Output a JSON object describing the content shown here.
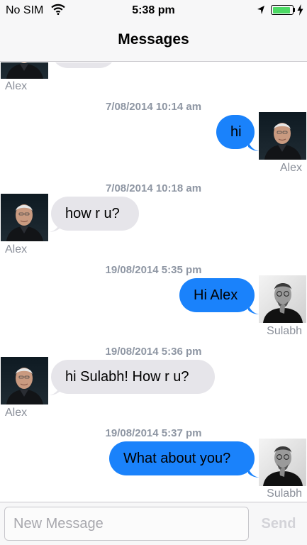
{
  "status_bar": {
    "carrier": "No SIM",
    "time": "5:38 pm",
    "battery_level": 0.92,
    "battery_color": "#4cd964"
  },
  "nav": {
    "title": "Messages"
  },
  "messages": [
    {
      "sender": "Alex",
      "direction": "incoming",
      "text": "",
      "timestamp": "",
      "avatar": "alex-avatar"
    },
    {
      "sender": "Alex",
      "direction": "outgoing",
      "text": "hi",
      "timestamp": "7/08/2014 10:14 am",
      "avatar": "alex-avatar"
    },
    {
      "sender": "Alex",
      "direction": "incoming",
      "text": "how r u?",
      "timestamp": "7/08/2014 10:18 am",
      "avatar": "alex-avatar"
    },
    {
      "sender": "Sulabh",
      "direction": "outgoing",
      "text": "Hi Alex",
      "timestamp": "19/08/2014 5:35 pm",
      "avatar": "sulabh-avatar"
    },
    {
      "sender": "Alex",
      "direction": "incoming",
      "text": "hi Sulabh! How r u?",
      "timestamp": "19/08/2014 5:36 pm",
      "avatar": "alex-avatar"
    },
    {
      "sender": "Sulabh",
      "direction": "outgoing",
      "text": "What about you?",
      "timestamp": "19/08/2014 5:37 pm",
      "avatar": "sulabh-avatar"
    }
  ],
  "input": {
    "placeholder": "New Message",
    "value": "",
    "send_label": "Send"
  },
  "colors": {
    "incoming_bubble": "#e6e5ea",
    "outgoing_bubble": "#1a82fb",
    "timestamp": "#8e96a3",
    "sender_label": "#8a8f99"
  }
}
